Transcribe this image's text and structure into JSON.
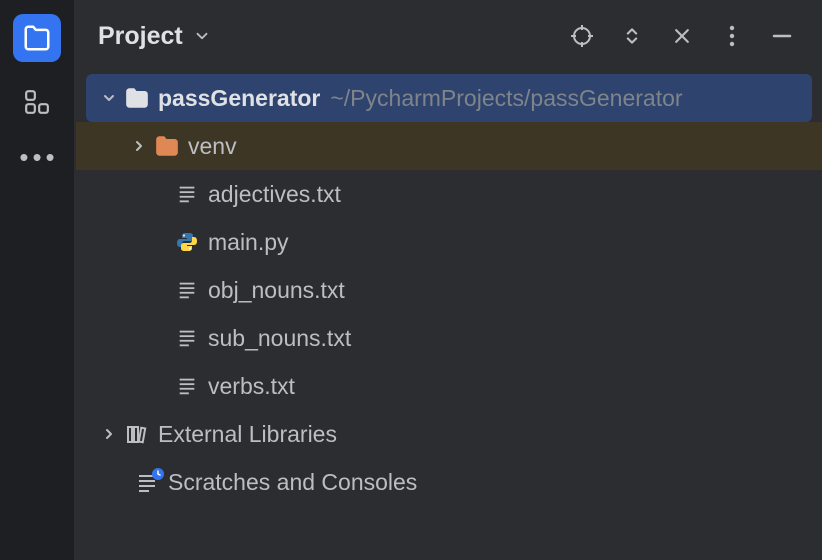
{
  "header": {
    "title": "Project"
  },
  "tree": {
    "root": {
      "name": "passGenerator",
      "path": "~/PycharmProjects/passGenerator"
    },
    "venv": {
      "name": "venv"
    },
    "files": [
      {
        "name": "adjectives.txt",
        "icon": "text"
      },
      {
        "name": "main.py",
        "icon": "python"
      },
      {
        "name": "obj_nouns.txt",
        "icon": "text"
      },
      {
        "name": "sub_nouns.txt",
        "icon": "text"
      },
      {
        "name": "verbs.txt",
        "icon": "text"
      }
    ],
    "external": "External Libraries",
    "scratches": "Scratches and Consoles"
  }
}
